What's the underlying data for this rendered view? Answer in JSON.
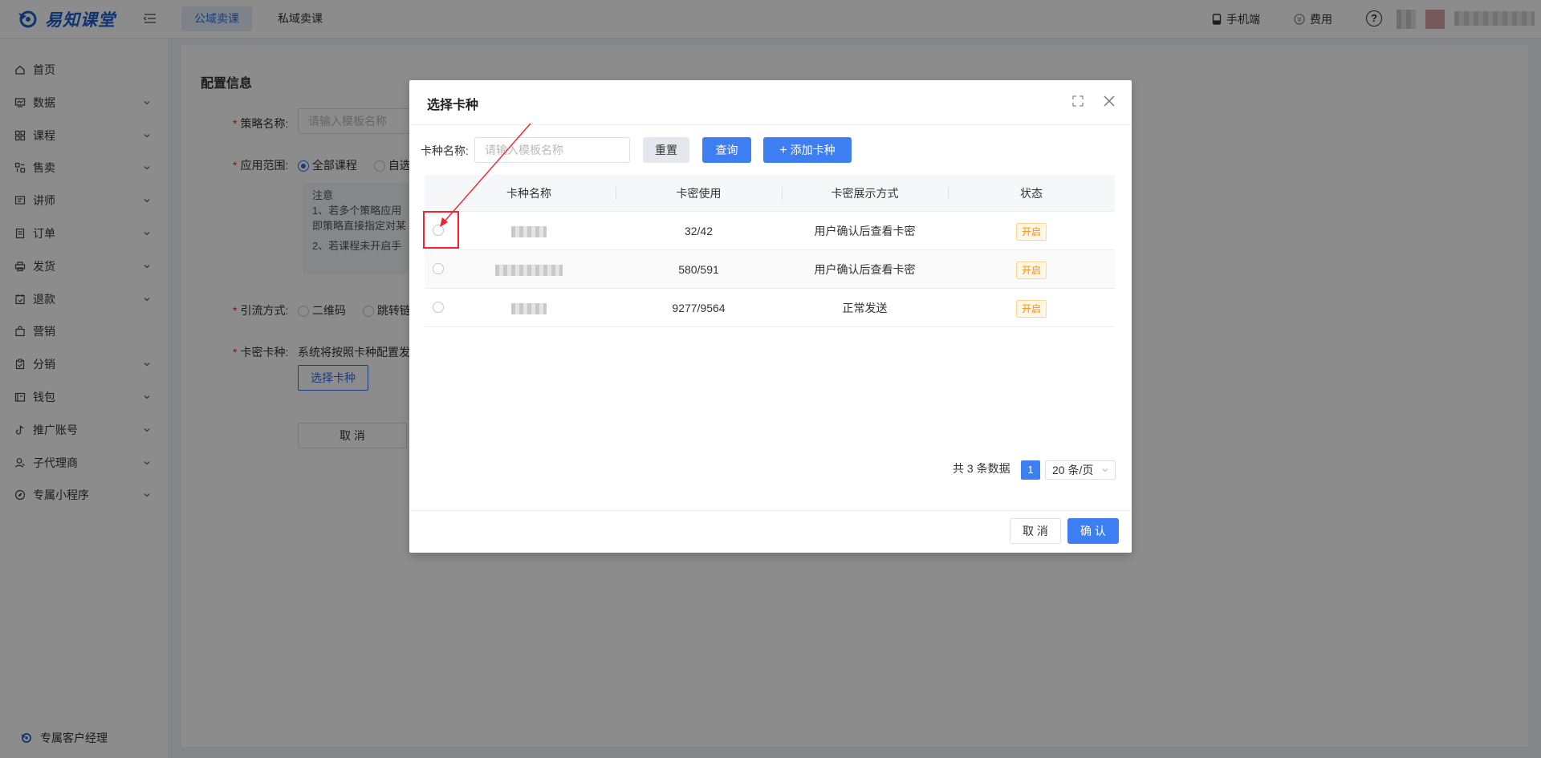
{
  "brand": {
    "name": "易知课堂"
  },
  "topbar": {
    "tabs": [
      "公域卖课",
      "私域卖课"
    ],
    "mobile": "手机端",
    "fee": "费用",
    "help": "?"
  },
  "sidebar": {
    "items": [
      {
        "label": "首页",
        "icon": "home-icon",
        "expand": false
      },
      {
        "label": "数据",
        "icon": "chart-icon",
        "expand": true
      },
      {
        "label": "课程",
        "icon": "grid-icon",
        "expand": true
      },
      {
        "label": "售卖",
        "icon": "shop-icon",
        "expand": true
      },
      {
        "label": "讲师",
        "icon": "teacher-icon",
        "expand": true
      },
      {
        "label": "订单",
        "icon": "order-icon",
        "expand": true
      },
      {
        "label": "发货",
        "icon": "printer-icon",
        "expand": true
      },
      {
        "label": "退款",
        "icon": "refund-icon",
        "expand": true
      },
      {
        "label": "营销",
        "icon": "bag-icon",
        "expand": false
      },
      {
        "label": "分销",
        "icon": "clipboard-icon",
        "expand": true
      },
      {
        "label": "钱包",
        "icon": "wallet-icon",
        "expand": true
      },
      {
        "label": "推广账号",
        "icon": "tiktok-icon",
        "expand": true
      },
      {
        "label": "子代理商",
        "icon": "agent-icon",
        "expand": true
      },
      {
        "label": "专属小程序",
        "icon": "compass-icon",
        "expand": true
      }
    ],
    "bottom": "专属客户经理"
  },
  "form": {
    "section_title": "配置信息",
    "strategy_name_label": "策略名称:",
    "strategy_name_placeholder": "请输入模板名称",
    "scope_label": "应用范围:",
    "scope_all": "全部课程",
    "scope_custom": "自选",
    "note_title": "注意",
    "note_line1": "1、若多个策略应用",
    "note_line2": "即策略直接指定对某",
    "note_line3": "2、若课程未开启手",
    "traffic_label": "引流方式:",
    "traffic_qr": "二维码",
    "traffic_jump": "跳转链",
    "card_label": "卡密卡种:",
    "card_desc": "系统将按照卡种配置发",
    "select_card_btn": "选择卡种",
    "cancel_btn": "取 消"
  },
  "modal": {
    "title": "选择卡种",
    "filter_label": "卡种名称:",
    "filter_placeholder": "请输入模板名称",
    "reset": "重置",
    "query": "查询",
    "add": "添加卡种",
    "columns": [
      "卡种名称",
      "卡密使用",
      "卡密展示方式",
      "状态"
    ],
    "rows": [
      {
        "usage": "32/42",
        "display": "用户确认后查看卡密",
        "status": "开启"
      },
      {
        "usage": "580/591",
        "display": "用户确认后查看卡密",
        "status": "开启"
      },
      {
        "usage": "9277/9564",
        "display": "正常发送",
        "status": "开启"
      }
    ],
    "total": "共 3 条数据",
    "page": "1",
    "page_size": "20 条/页",
    "cancel": "取 消",
    "confirm": "确 认"
  }
}
